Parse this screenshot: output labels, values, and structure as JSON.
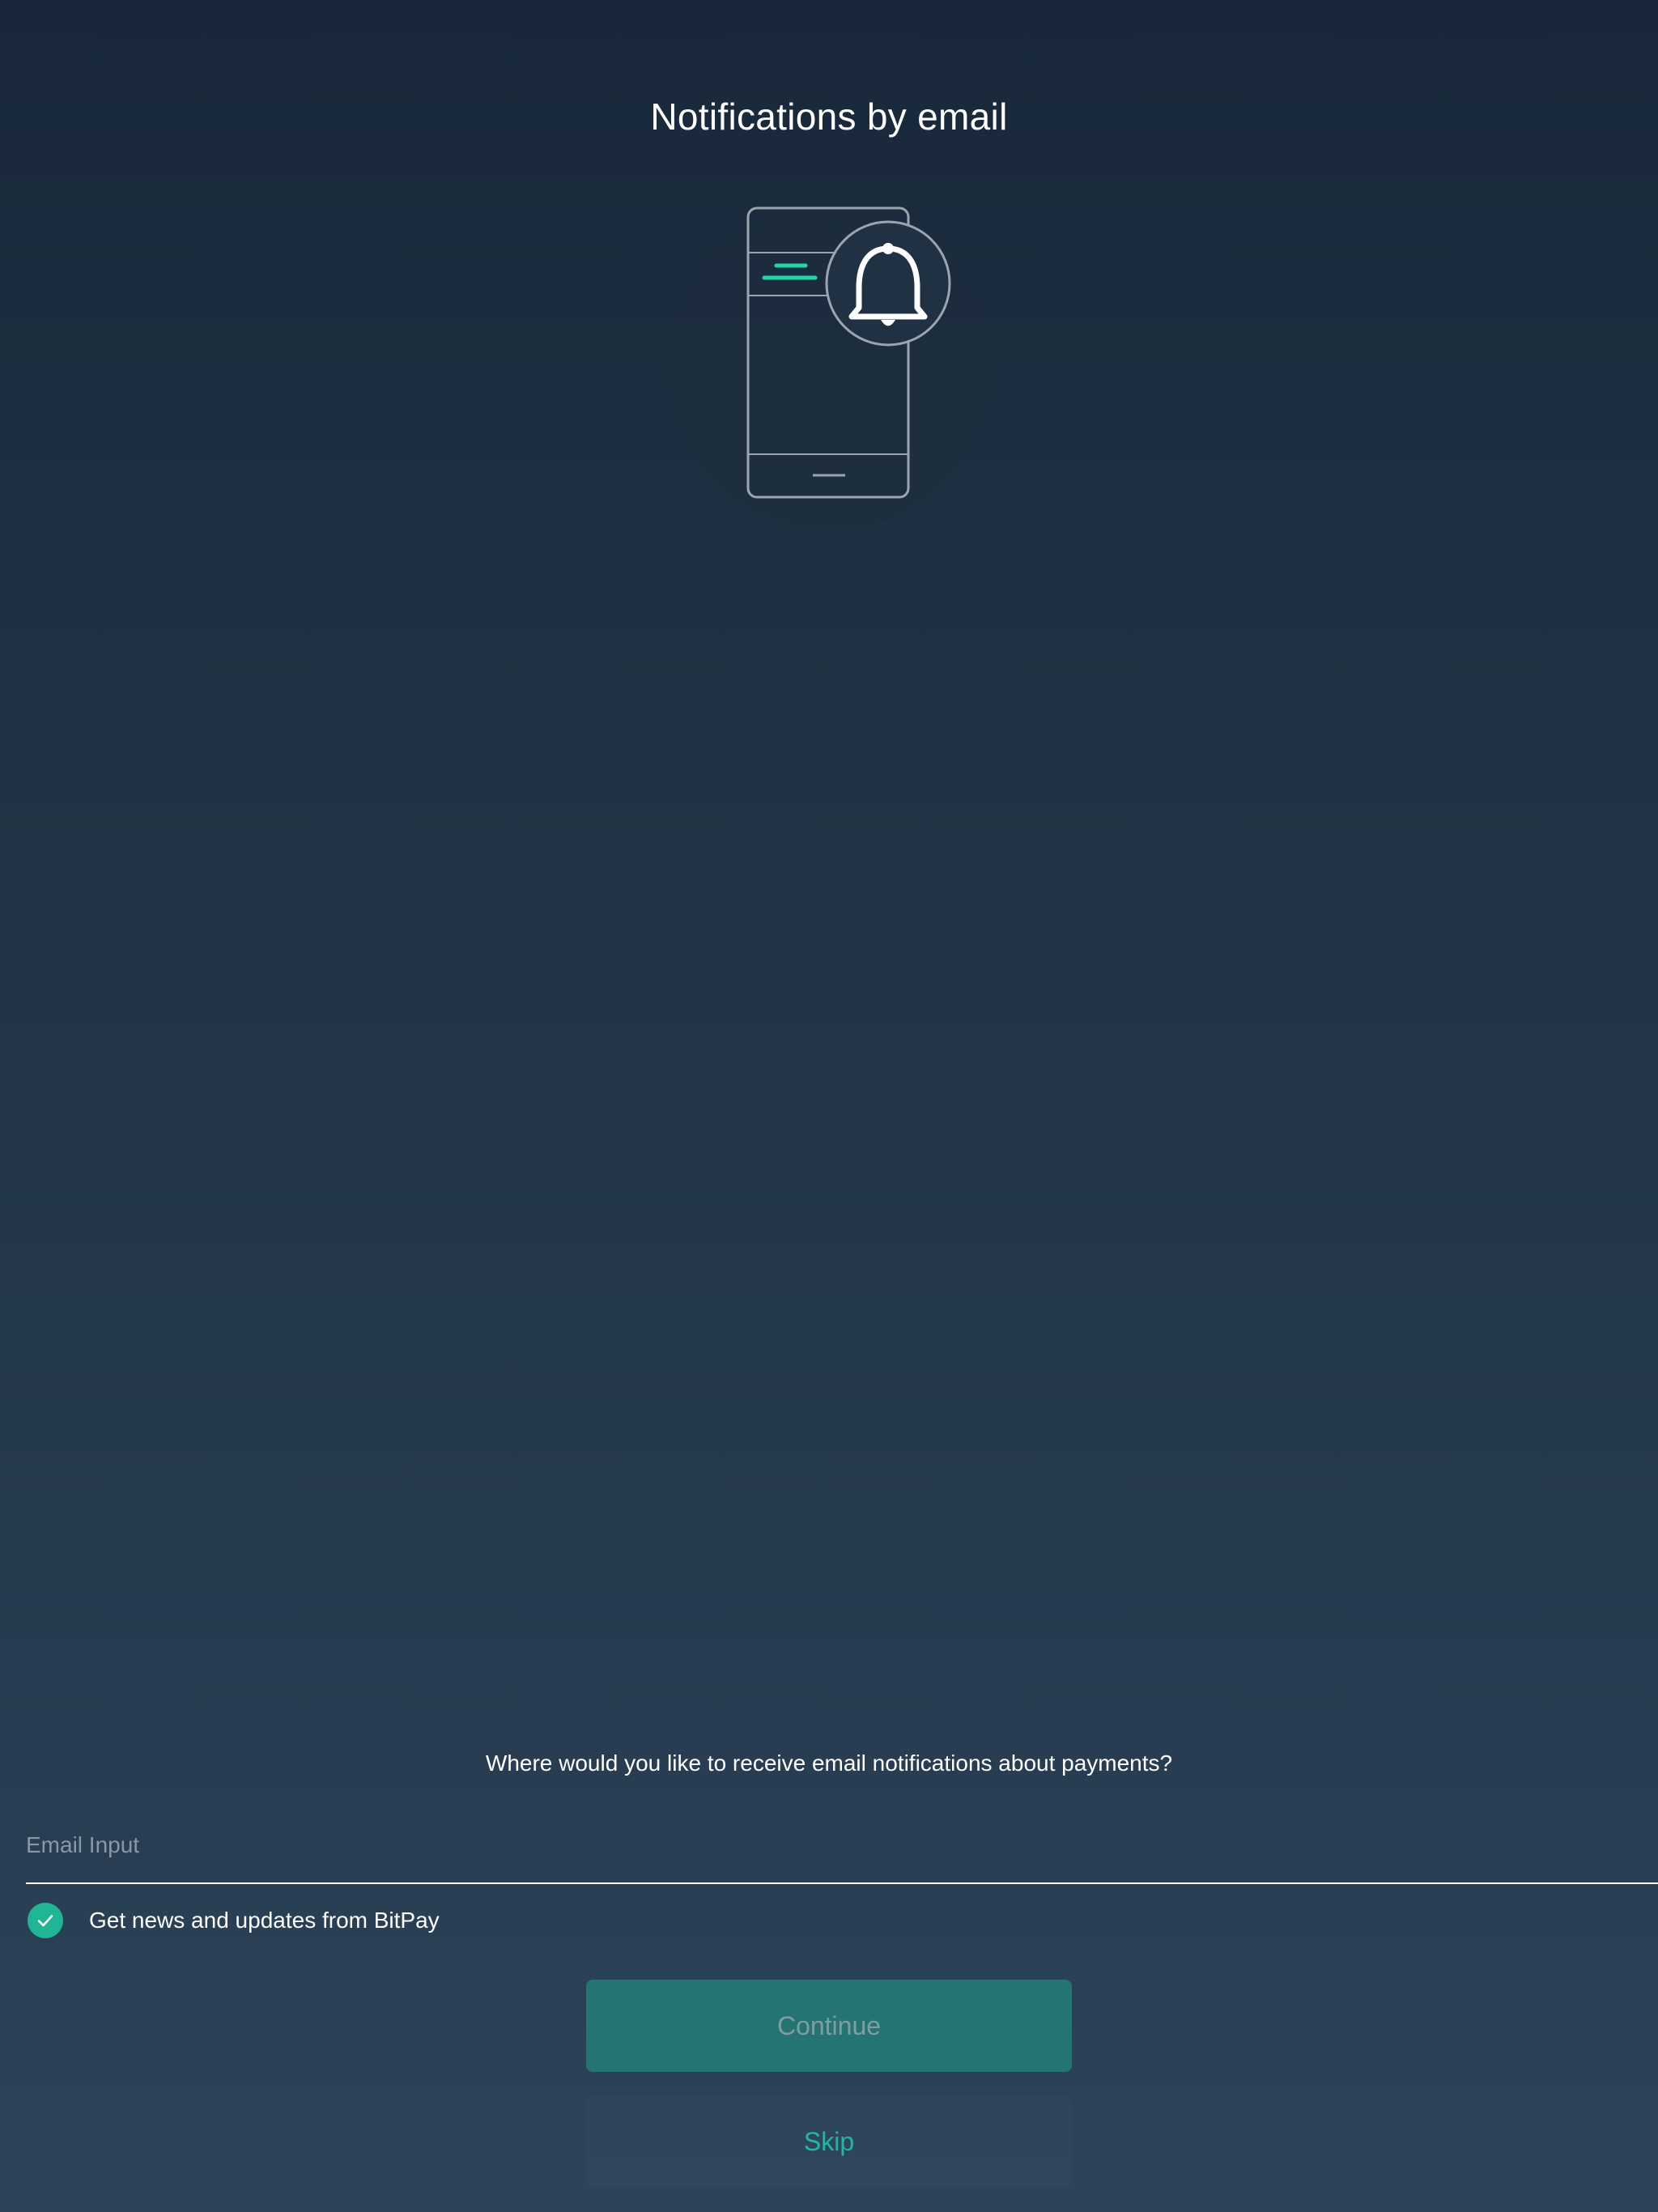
{
  "page": {
    "title": "Notifications by email"
  },
  "illustration": {
    "icon": "phone-with-bell-icon"
  },
  "form": {
    "question": "Where would you like to receive email notifications about payments?",
    "email_placeholder": "Email Input",
    "email_value": "",
    "newsletter_label": "Get news and updates from BitPay",
    "newsletter_checked": true
  },
  "actions": {
    "continue_label": "Continue",
    "skip_label": "Skip"
  },
  "colors": {
    "accent": "#1fb595",
    "continue_bg": "#247473",
    "skip_text": "#1fb9a0",
    "background_top": "#18283a",
    "background_bottom": "#2c4359"
  }
}
